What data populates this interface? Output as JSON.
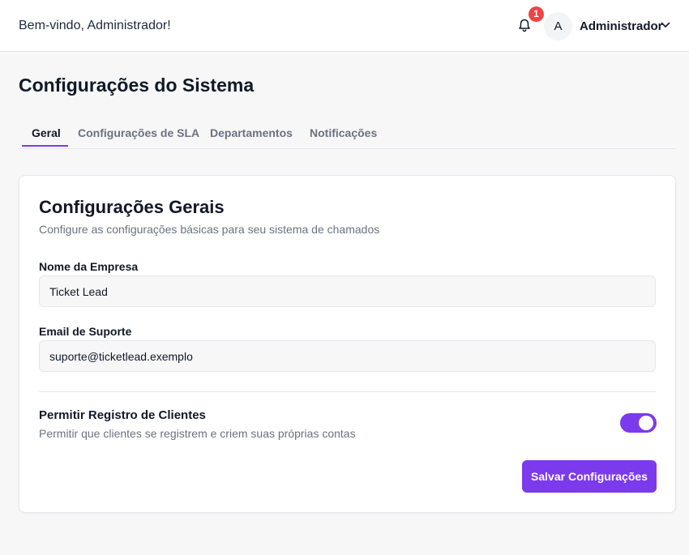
{
  "header": {
    "welcome": "Bem-vindo, Administrador!",
    "notification_count": "1",
    "avatar_initial": "A",
    "username": "Administrador",
    "icons": {
      "bell": "bell-icon",
      "user_menu": "chevron-down-icon"
    }
  },
  "page": {
    "title": "Configurações do Sistema",
    "tabs": [
      {
        "label": "Geral",
        "active": true
      },
      {
        "label": "Configurações de SLA",
        "active": false
      },
      {
        "label": "Departamentos",
        "active": false
      },
      {
        "label": "Notificações",
        "active": false
      }
    ]
  },
  "card": {
    "title": "Configurações Gerais",
    "subtitle": "Configure as configurações básicas para seu sistema de chamados",
    "company": {
      "label": "Nome da Empresa",
      "value": "Ticket Lead"
    },
    "email": {
      "label": "Email de Suporte",
      "value": "suporte@ticketlead.exemplo"
    },
    "registration": {
      "label": "Permitir Registro de Clientes",
      "description": "Permitir que clientes se registrem e criem suas próprias contas",
      "enabled": true
    },
    "save_label": "Salvar Configurações"
  },
  "colors": {
    "accent": "#7c3aed",
    "badge": "#ef4444",
    "background": "#f7f7f8"
  }
}
